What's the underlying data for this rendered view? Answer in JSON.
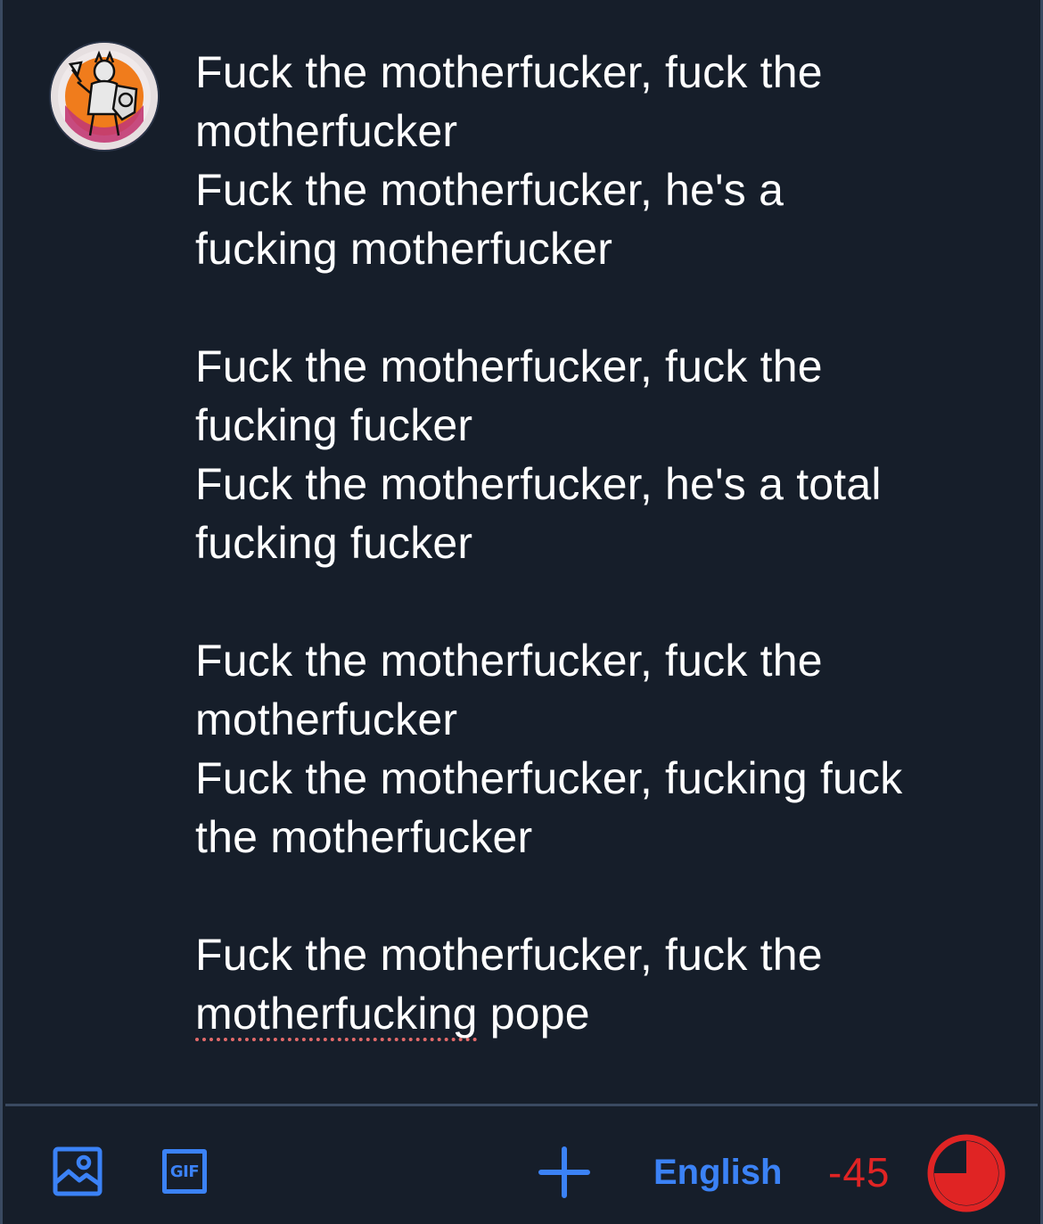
{
  "avatar": {
    "icon": "avatar-knight-icon"
  },
  "compose": {
    "stanzas": [
      {
        "lines": [
          "Fuck the motherfucker, fuck the",
          "motherfucker",
          "Fuck the motherfucker, he's a",
          "fucking motherfucker"
        ]
      },
      {
        "lines": [
          "Fuck the motherfucker, fuck the",
          "fucking fucker",
          "Fuck the motherfucker, he's a total",
          "fucking fucker"
        ]
      },
      {
        "lines": [
          "Fuck the motherfucker, fuck the",
          "motherfucker",
          "Fuck the motherfucker, fucking fuck",
          "the motherfucker"
        ]
      },
      {
        "lines": [
          "Fuck the motherfucker, fuck the"
        ],
        "last_line": {
          "misspelled": "motherfucking",
          "rest": " pope"
        }
      }
    ]
  },
  "toolbar": {
    "image_icon": "image-icon",
    "gif_label": "GIF",
    "add_icon": "plus-icon",
    "language": "English",
    "char_count": "-45",
    "progress_icon": "character-limit-ring-icon",
    "progress_fraction": 0.75
  },
  "colors": {
    "background": "#161e2a",
    "accent": "#3b82f6",
    "error": "#e02424",
    "divider": "#3a4a61",
    "spellcheck": "#e26a6a"
  }
}
